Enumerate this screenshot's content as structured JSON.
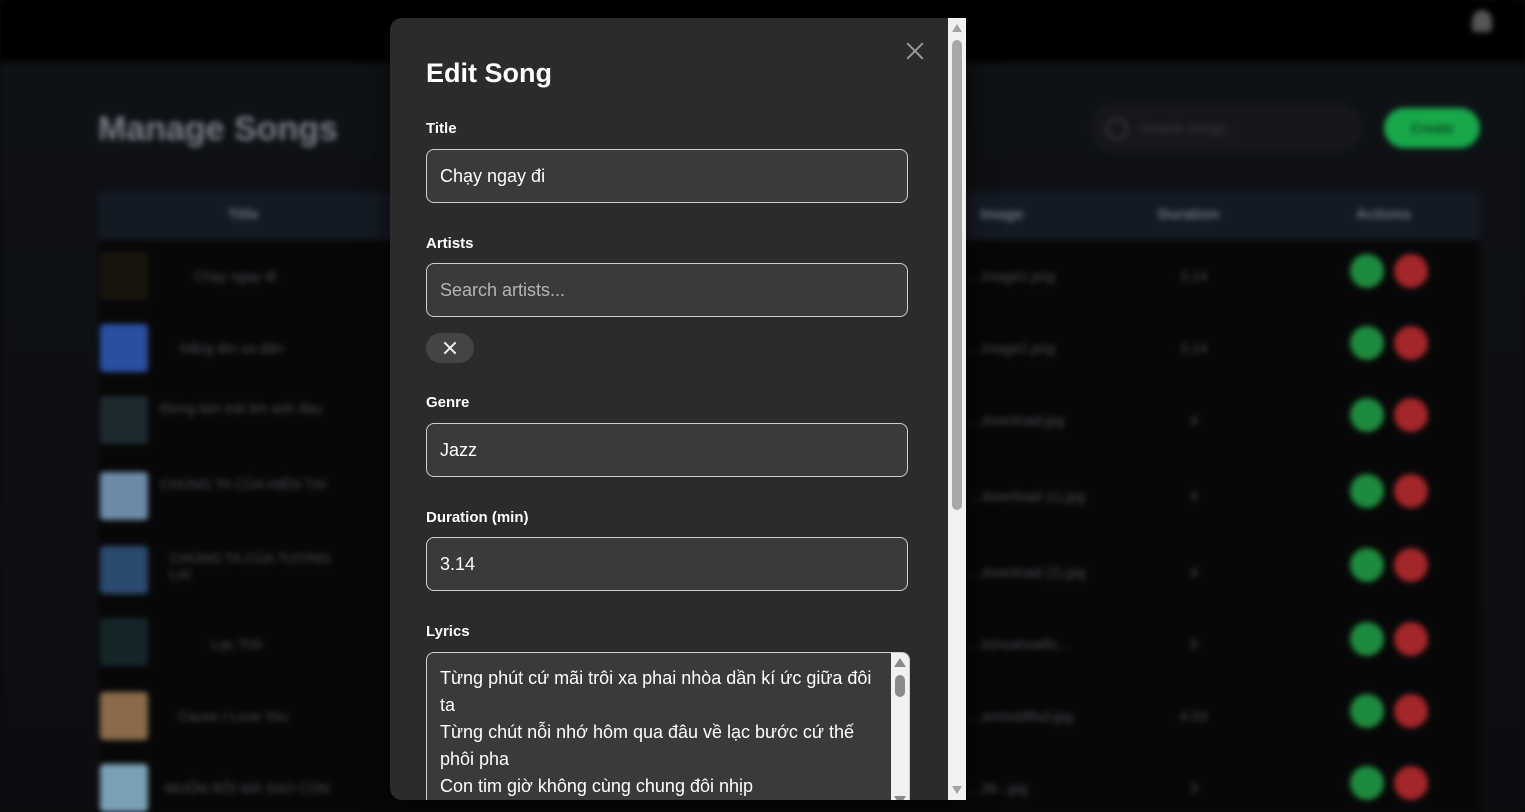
{
  "background": {
    "page_title": "Manage Songs",
    "search_placeholder": "Search songs...",
    "create_label": "Create",
    "columns": [
      "Title",
      "Image",
      "Duration",
      "Actions"
    ],
    "rows": [
      {
        "title": "Chạy ngay đi",
        "image": "...image1.png",
        "duration": "3.14"
      },
      {
        "title": "Nắng ấm xa dần",
        "image": "...image2.png",
        "duration": "3.14"
      },
      {
        "title": "Đừng làm trái tim anh đau",
        "image": "...download.jpg",
        "duration": "4"
      },
      {
        "title": "CHÚNG TA CỦA HIỆN TẠI",
        "image": "...download (1).jpg",
        "duration": "4"
      },
      {
        "title": "CHÚNG TA CỦA TƯƠNG LAI",
        "image": "...download (2).jpg",
        "duration": "4"
      },
      {
        "title": "Lạc Trôi",
        "image": "...itshoahoaflo...",
        "duration": "5"
      },
      {
        "title": "Cause I Love You",
        "image": "...anmuldflud.jpg",
        "duration": "4.53"
      },
      {
        "title": "MUỘN RỒI MÀ SAO CÒN",
        "image": "...98...jpg",
        "duration": "3"
      }
    ]
  },
  "modal": {
    "title": "Edit Song",
    "fields": {
      "title": {
        "label": "Title",
        "value": "Chạy ngay đi"
      },
      "artists": {
        "label": "Artists",
        "placeholder": "Search artists..."
      },
      "genre": {
        "label": "Genre",
        "value": "Jazz"
      },
      "duration": {
        "label": "Duration (min)",
        "value": "3.14"
      },
      "lyrics": {
        "label": "Lyrics",
        "value": "Từng phút cứ mãi trôi xa phai nhòa dần kí ức giữa đôi ta\nTừng chút nỗi nhớ hôm qua đâu về lạc bước cứ thế phôi pha\nCon tim giờ không cùng chung đôi nhịp"
      }
    }
  },
  "icons": {
    "close": "close-icon",
    "chip_remove": "close-icon",
    "search": "search-icon",
    "user": "user-icon"
  },
  "colors": {
    "modal_bg": "#2b2b2b",
    "input_bg": "#3a3a3a",
    "create_green": "#18a84a",
    "edit_green": "#1e8a3e",
    "delete_red": "#a3262a"
  }
}
